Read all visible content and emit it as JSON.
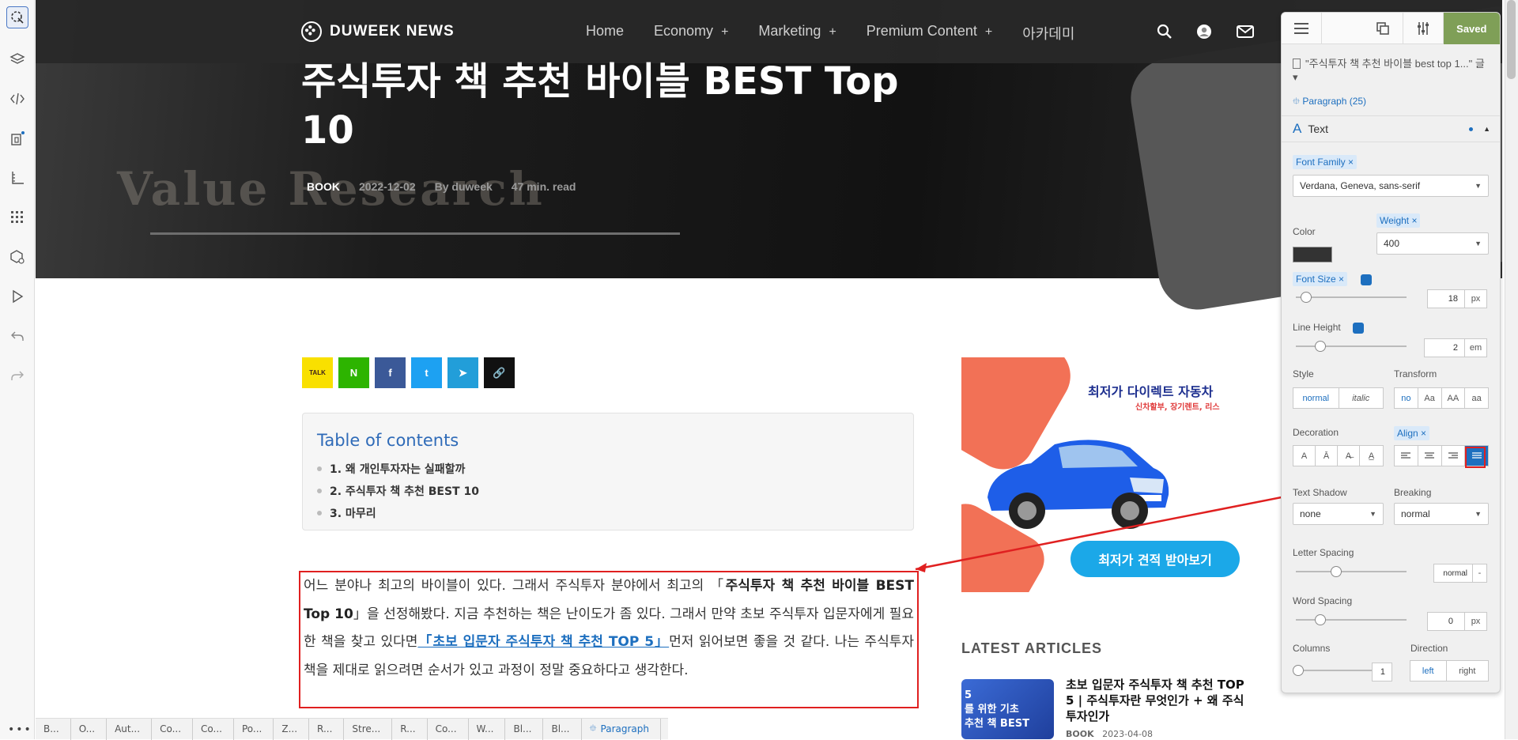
{
  "site": {
    "brand": "DUWEEK NEWS",
    "nav": [
      {
        "label": "Home",
        "has_plus": false
      },
      {
        "label": "Economy",
        "has_plus": true
      },
      {
        "label": "Marketing",
        "has_plus": true
      },
      {
        "label": "Premium Content",
        "has_plus": true
      },
      {
        "label": "아카데미",
        "has_plus": false
      }
    ],
    "nav_plus": "+",
    "hero_bg_word": "Value Research"
  },
  "post": {
    "title": "주식투자 책 추천 바이블 BEST Top 10",
    "category": "BOOK",
    "date": "2022-12-02",
    "author": "By duweek",
    "read_time": "47 min. read"
  },
  "share": [
    {
      "icon": "kakaotalk-icon",
      "label": "TALK",
      "color": "#f9e000",
      "text_color": "#3a1d1d"
    },
    {
      "icon": "naver-icon",
      "label": "N",
      "color": "#2db400",
      "text_color": "#ffffff"
    },
    {
      "icon": "facebook-icon",
      "label": "f",
      "color": "#3b5998",
      "text_color": "#ffffff"
    },
    {
      "icon": "twitter-icon",
      "label": "t",
      "color": "#1da1f2",
      "text_color": "#ffffff"
    },
    {
      "icon": "telegram-icon",
      "label": "➤",
      "color": "#229ed9",
      "text_color": "#ffffff"
    },
    {
      "icon": "copy-link-icon",
      "label": "🔗",
      "color": "#111111",
      "text_color": "#ffffff"
    }
  ],
  "toc": {
    "title": "Table of contents",
    "items": [
      "1. 왜 개인투자자는 실패할까",
      "2. 주식투자 책 추천 BEST 10",
      "3. 마무리"
    ]
  },
  "paragraph": {
    "part1": "어느 분야나 최고의 바이블이 있다. 그래서 주식투자 분야에서 최고의 「",
    "bold": "주식투자 책 추천 바이블 BEST Top 10",
    "part2": "」을 선정해봤다. 지금 추천하는 책은 난이도가 좀 있다. 그래서 만약 초보 주식투자 입문자에게 필요한 책을 찾고 있다면",
    "link": "「초보 입문자 주식투자 책 추천 TOP 5」",
    "part3": "먼저 읽어보면 좋을 것 같다. 나는 주식투자 책을 제대로 읽으려면 순서가 있고 과정이 정말 중요하다고 생각한다."
  },
  "ad": {
    "headline": "최저가 다이렉트 자동차",
    "subline": "신차할부, 장기렌트, 리스",
    "button": "최저가 견적 받아보기",
    "colors": {
      "accent": "#f27156",
      "car": "#1e5ee8",
      "button": "#1ba8e8"
    }
  },
  "latest": {
    "section_title": "LATEST ARTICLES",
    "thumb_text": "5\n를 위한 기초\n추천 책 BEST",
    "headline": "초보 입문자 주식투자 책 추천 TOP 5 | 주식투자란 무엇인가 + 왜 주식투자인가",
    "category": "BOOK",
    "date": "2023-04-08"
  },
  "breadcrumbs": [
    "B...",
    "O...",
    "Aut...",
    "Co...",
    "Co...",
    "Po...",
    "Z...",
    "R...",
    "Stre...",
    "R...",
    "Co...",
    "W...",
    "Bl...",
    "Bl..."
  ],
  "breadcrumb_active": "Paragraph",
  "more_dots": "•••",
  "panel": {
    "saved": "Saved",
    "doc_label": "\"주식투자 책 추천 바이블 best top 1...\" 글 ▾",
    "element": "Paragraph (25)",
    "section": "Text",
    "font_family_tag": "Font Family ×",
    "font_family_value": "Verdana, Geneva, sans-serif",
    "color_label": "Color",
    "color_value": "#333333",
    "weight_tag": "Weight ×",
    "weight_value": "400",
    "font_size_tag": "Font Size ×",
    "font_size_value": "18",
    "font_size_unit": "px",
    "line_height_label": "Line Height",
    "line_height_value": "2",
    "line_height_unit": "em",
    "style_label": "Style",
    "style_options": [
      "normal",
      "italic"
    ],
    "transform_label": "Transform",
    "transform_options": [
      "no",
      "Aa",
      "AA",
      "aa"
    ],
    "decoration_label": "Decoration",
    "decoration_options": [
      "A",
      "Ā",
      "A̶",
      "A̲"
    ],
    "align_tag": "Align ×",
    "text_shadow_label": "Text Shadow",
    "text_shadow_value": "none",
    "breaking_label": "Breaking",
    "breaking_value": "normal",
    "letter_spacing_label": "Letter Spacing",
    "letter_spacing_value": "normal",
    "letter_spacing_unit": "-",
    "word_spacing_label": "Word Spacing",
    "word_spacing_value": "0",
    "word_spacing_unit": "px",
    "columns_label": "Columns",
    "columns_value": "1",
    "direction_label": "Direction",
    "direction_options": [
      "left",
      "right"
    ]
  },
  "colors": {
    "annotation": "#e02020",
    "link": "#1d6fbf",
    "saved": "#7f9f57"
  }
}
